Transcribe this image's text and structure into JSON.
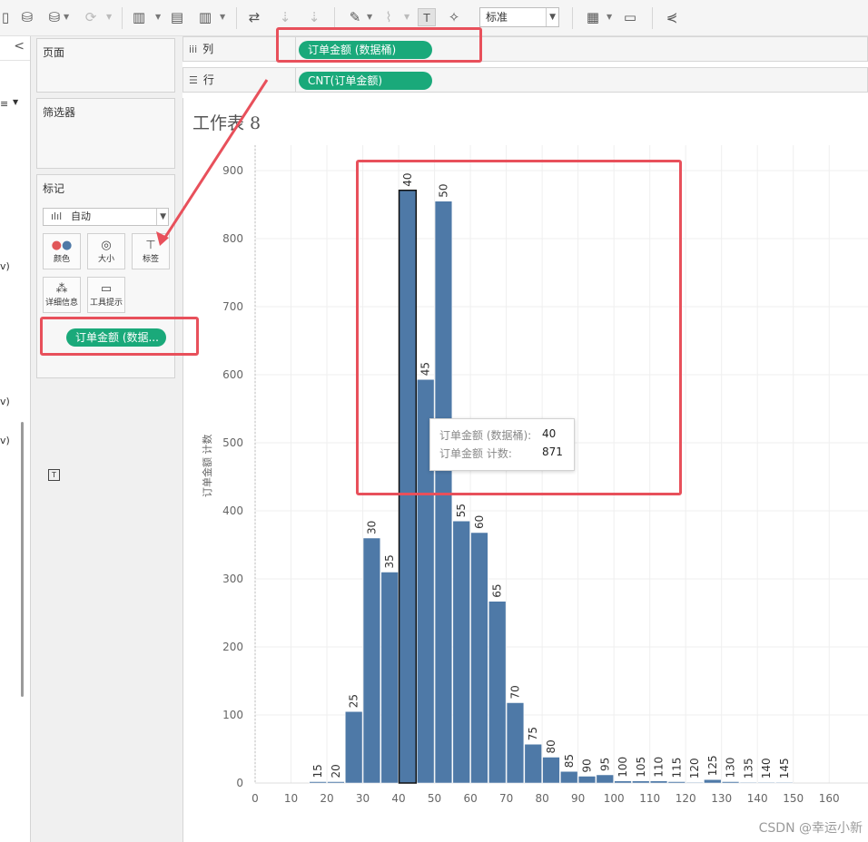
{
  "toolbar": {
    "mark_label_button": "T",
    "fit_select": "标准",
    "icons": [
      "datasource-icon",
      "new-datasource-icon",
      "pause-icon",
      "refresh-icon",
      "new-worksheet-icon",
      "duplicate-icon",
      "clear-sheet-icon",
      "swap-icon",
      "sort-asc-icon",
      "sort-desc-icon",
      "highlight-icon",
      "group-icon",
      "show-labels-icon",
      "pin-icon",
      "show-me-icon",
      "presentation-icon",
      "share-icon"
    ]
  },
  "left_strip": {
    "collapse": "<",
    "fragments": [
      "≡",
      "v)",
      "v)",
      "v)"
    ]
  },
  "cards": {
    "pages_title": "页面",
    "filters_title": "筛选器",
    "marks_title": "标记",
    "marks_type": "自动",
    "mark_buttons": [
      {
        "label": "颜色",
        "icon": "color-icon"
      },
      {
        "label": "大小",
        "icon": "size-icon"
      },
      {
        "label": "标签",
        "icon": "label-icon"
      },
      {
        "label": "详细信息",
        "icon": "detail-icon"
      },
      {
        "label": "工具提示",
        "icon": "tooltip-icon"
      }
    ],
    "mark_field": "订单金额 (数据..."
  },
  "shelves": {
    "columns_label": "列",
    "columns_pill": "订单金额 (数据桶)",
    "rows_label": "行",
    "rows_pill": "CNT(订单金额)"
  },
  "view": {
    "title": "工作表 8"
  },
  "chart_data": {
    "type": "bar",
    "title": "工作表 8",
    "xlabel": "",
    "ylabel": "订单金额 计数",
    "bin_size": 5,
    "x": [
      15,
      20,
      25,
      30,
      35,
      40,
      45,
      50,
      55,
      60,
      65,
      70,
      75,
      80,
      85,
      90,
      95,
      100,
      105,
      110,
      115,
      120,
      125,
      130,
      135,
      140,
      145
    ],
    "values": [
      2,
      2,
      105,
      360,
      310,
      871,
      593,
      855,
      385,
      368,
      267,
      118,
      57,
      38,
      17,
      10,
      12,
      3,
      3,
      3,
      2,
      1,
      5,
      2,
      1,
      1,
      1
    ],
    "xlim": [
      0,
      165
    ],
    "ylim": [
      0,
      920
    ],
    "x_ticks": [
      0,
      10,
      20,
      30,
      40,
      50,
      60,
      70,
      80,
      90,
      100,
      110,
      120,
      130,
      140,
      150,
      160
    ],
    "y_ticks": [
      0,
      100,
      200,
      300,
      400,
      500,
      600,
      700,
      800,
      900
    ],
    "bar_color": "#4e79a7",
    "selected_bar": 40,
    "grid": true
  },
  "tooltip": {
    "rows": [
      {
        "key": "订单金额 (数据桶):",
        "value": "40"
      },
      {
        "key": "订单金额 计数:",
        "value": "871"
      }
    ]
  },
  "annotation_color": "#e8505b",
  "watermark": "CSDN @幸运小新"
}
